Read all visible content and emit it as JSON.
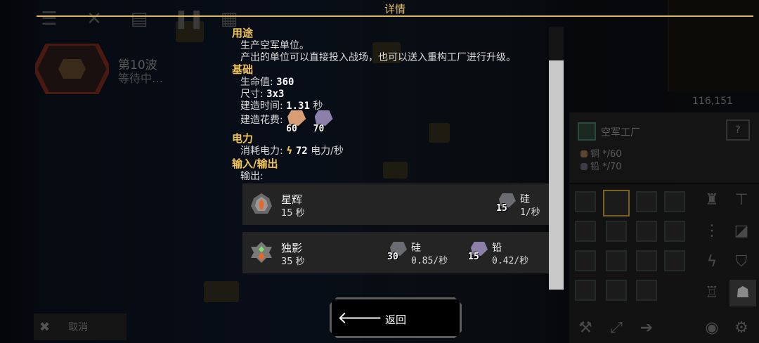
{
  "dialog": {
    "title": "详情"
  },
  "sections": {
    "usage": {
      "heading": "用途",
      "lines": [
        "生产空军单位。",
        "产出的单位可以直接投入战场，也可以送入重构工厂进行升级。"
      ]
    },
    "basics": {
      "heading": "基础",
      "health_label": "生命值:",
      "health_value": "360",
      "size_label": "尺寸:",
      "size_value": "3x3",
      "build_time_label": "建造时间:",
      "build_time_value": "1.31",
      "build_time_unit": "秒",
      "cost_label": "建造花费:",
      "costs": [
        {
          "item": "copper",
          "amount": "60",
          "color": "#d99d73"
        },
        {
          "item": "lead",
          "amount": "70",
          "color": "#8c7fa9"
        }
      ]
    },
    "power": {
      "heading": "电力",
      "use_label": "消耗电力:",
      "use_icon": "lightning-icon",
      "use_value": "72",
      "use_unit": "电力/秒"
    },
    "io": {
      "heading": "输入/输出",
      "output_label": "输出:",
      "units": [
        {
          "name": "星辉",
          "time": "15 秒",
          "icon": "flare-unit-icon",
          "requirements": [
            {
              "qty": "15",
              "name": "硅",
              "rate": "1/秒",
              "color": "#6b6b72"
            }
          ]
        },
        {
          "name": "独影",
          "time": "35 秒",
          "icon": "mono-unit-icon",
          "requirements": [
            {
              "qty": "30",
              "name": "硅",
              "rate": "0.85/秒",
              "color": "#6b6b72"
            },
            {
              "qty": "15",
              "name": "铅",
              "rate": "0.42/秒",
              "color": "#8c7fa9"
            }
          ]
        }
      ]
    }
  },
  "back_button": {
    "label": "返回",
    "icon": "arrow-left-icon"
  },
  "background": {
    "wave_title": "第10波",
    "wave_status": "等待中…",
    "coords": "116,151",
    "block_title": "空军工厂",
    "block_req_copper": "铜 */60",
    "block_req_lead": "铅 */70",
    "help_label": "?",
    "cancel_label": "取消"
  },
  "colors": {
    "accent": "#f0c35a",
    "title": "#e6c06c",
    "copper": "#d99d73",
    "lead": "#8c7fa9",
    "silicon": "#6b6b72"
  }
}
